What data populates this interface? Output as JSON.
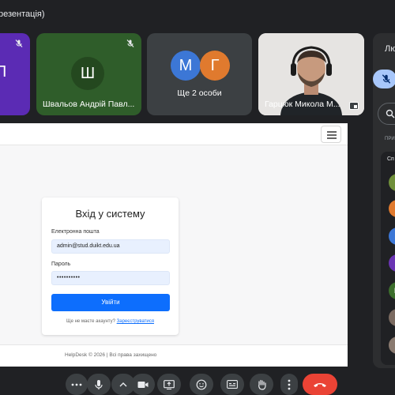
{
  "meeting": {
    "title": "резентація)"
  },
  "tiles": [
    {
      "initial": "П",
      "label": "ен",
      "color": "#5b2bb4"
    },
    {
      "initial": "Ш",
      "label": "Швальов Андрій Павл...",
      "color": "#2f5d2a"
    },
    {
      "initials": [
        "М",
        "Г"
      ],
      "label": "Ще 2 особи",
      "colors": [
        "#3c77d6",
        "#e07a2e"
      ]
    },
    {
      "label": "Гарцюк Микола М..."
    }
  ],
  "presentation": {
    "login_title": "Вхід у систему",
    "email_label": "Електронна пошта",
    "email_value": "admin@stud.duikt.edu.ua",
    "password_label": "Пароль",
    "password_value": "••••••••••",
    "login_button": "Увійти",
    "register_prompt": "Ще не маєте акаунту?",
    "register_link": "Зареєструватися",
    "footer": "HelpDesk © 2026 | Всі права захищено"
  },
  "side_panel": {
    "title": "Лю",
    "caption": "ПРИ",
    "list_title": "Сп",
    "avatars": [
      {
        "initial": "П",
        "color": "#6f8f3a"
      },
      {
        "initial": "П",
        "color": "#e07a2e"
      },
      {
        "initial": "М",
        "color": "#3c77d6"
      },
      {
        "initial": "П",
        "color": "#6a34b3"
      },
      {
        "initial": "Ш",
        "color": "#3c6e2c"
      },
      {
        "initial": "L",
        "color": "#7a6a60"
      },
      {
        "initial": "L",
        "color": "#8a7a70"
      }
    ]
  },
  "controls": {
    "icons": [
      "more-dots-icon",
      "microphone-icon",
      "chevron-up-icon",
      "camera-icon",
      "present-screen-icon",
      "emoji-icon",
      "captions-icon",
      "raise-hand-icon",
      "more-vert-icon",
      "end-call-icon"
    ],
    "end_call_color": "#ea4335"
  }
}
